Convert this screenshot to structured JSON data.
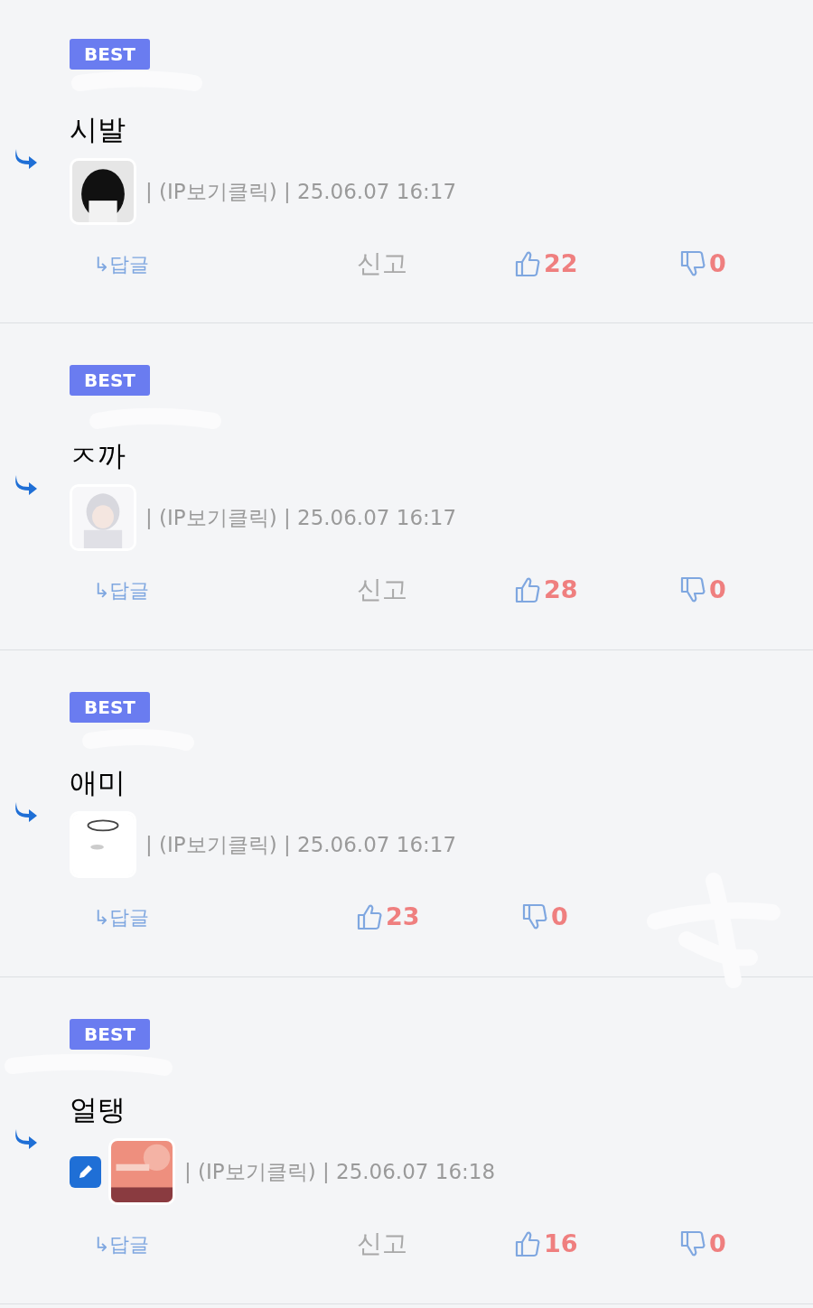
{
  "comments": [
    {
      "badge": "BEST",
      "text": "시발",
      "editable": false,
      "meta": "| (IP보기클릭) | 25.06.07 16:17",
      "reply": "↳답글",
      "report": "신고",
      "likes": "22",
      "dislikes": "0"
    },
    {
      "badge": "BEST",
      "text": "ㅈ까",
      "editable": false,
      "meta": "| (IP보기클릭) | 25.06.07 16:17",
      "reply": "↳답글",
      "report": "신고",
      "likes": "28",
      "dislikes": "0"
    },
    {
      "badge": "BEST",
      "text": "애미",
      "editable": false,
      "meta": "| (IP보기클릭) | 25.06.07 16:17",
      "reply": "↳답글",
      "likes": "23",
      "dislikes": "0"
    },
    {
      "badge": "BEST",
      "text": "얼탱",
      "editable": true,
      "meta": "| (IP보기클릭) | 25.06.07 16:18",
      "reply": "↳답글",
      "report": "신고",
      "likes": "16",
      "dislikes": "0"
    }
  ]
}
